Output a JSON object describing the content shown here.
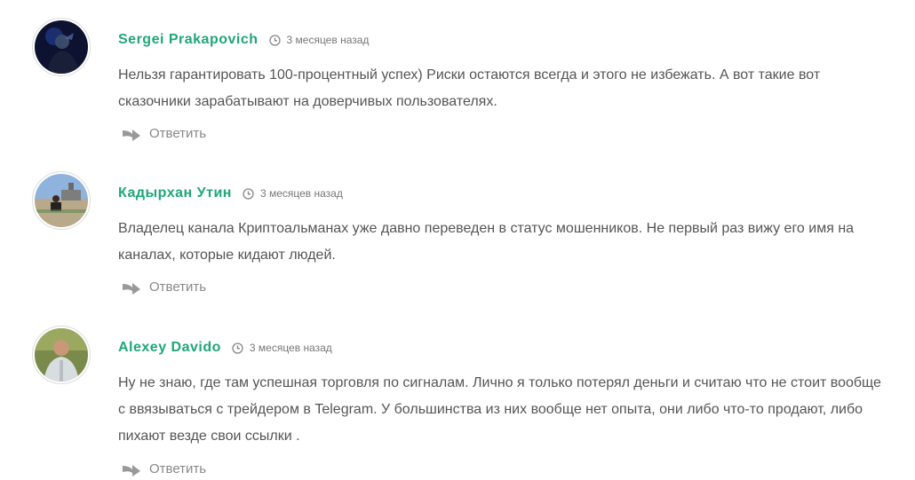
{
  "comments": [
    {
      "author": "Sergei Prakapovich",
      "time": "3 месяцев назад",
      "text": "Нельзя гарантировать 100-процентный успех) Риски остаются всегда и этого не избежать. А вот такие вот сказочники зарабатывают на доверчивых пользователях.",
      "reply_label": "Ответить",
      "avatar_icon": "user-photo-icon"
    },
    {
      "author": "Кадырхан Утин",
      "time": "3 месяцев назад",
      "text": "Владелец канала Криптоальманах уже давно переведен в статус мошенников. Не первый раз вижу его имя на каналах, которые кидают людей.",
      "reply_label": "Ответить",
      "avatar_icon": "user-photo-icon"
    },
    {
      "author": "Alexey Davido",
      "time": "3 месяцев назад",
      "text": "Ну не знаю, где там успешная торговля по сигналам. Лично я только потерял деньги и считаю что не стоит вообще с ввязываться с трейдером в Telegram. У большинства из них вообще нет опыта, они либо что-то продают, либо пихают везде свои ссылки .",
      "reply_label": "Ответить",
      "avatar_icon": "user-photo-icon"
    }
  ],
  "colors": {
    "author": "#1fa67a",
    "text": "#555555",
    "meta": "#777777",
    "reply": "#888888"
  }
}
